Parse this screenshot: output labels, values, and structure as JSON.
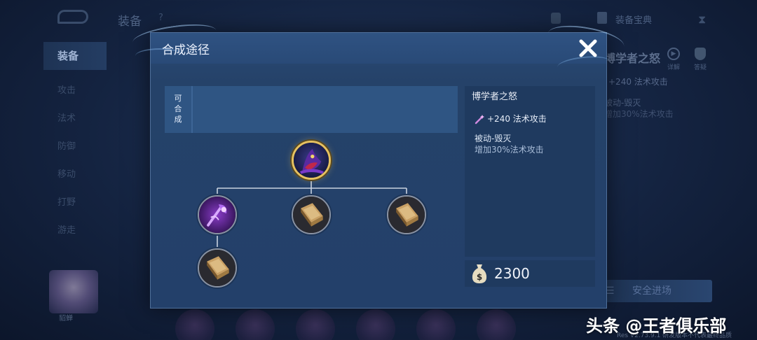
{
  "background": {
    "title": "装备",
    "title_hint": "?",
    "dictionary_label": "装备宝典",
    "sidebar": [
      {
        "label": "装备",
        "active": true
      },
      {
        "label": "攻击",
        "active": false
      },
      {
        "label": "法术",
        "active": false
      },
      {
        "label": "防御",
        "active": false
      },
      {
        "label": "移动",
        "active": false
      },
      {
        "label": "打野",
        "active": false
      },
      {
        "label": "游走",
        "active": false
      }
    ],
    "hero_name": "貂蝉",
    "right_item_name": "博学者之怒",
    "right_stat": "+240 法术攻击",
    "right_passive": "被动-毁灭",
    "right_passive_desc": "增加30%法术攻击",
    "play_label": "详解",
    "drill_label": "答疑",
    "safe_button_label": "安全进场",
    "version_text": "Res V2.73.9.1 研发版本不代表最终品质"
  },
  "dialog": {
    "title": "合成途径",
    "close_icon": "close-x-icon",
    "craftable_label": [
      "可",
      "合",
      "成"
    ],
    "tree": {
      "root": {
        "item": "博学者之怒",
        "icon": "wizard-hat-icon",
        "rarity_color": "#e6c160"
      },
      "children": [
        {
          "item": "梦魇之牙",
          "icon": "purple-staff-icon",
          "children": [
            {
              "item": "咒术典籍",
              "icon": "book-icon"
            }
          ]
        },
        {
          "item": "咒术典籍",
          "icon": "book-icon"
        },
        {
          "item": "咒术典籍",
          "icon": "book-icon"
        }
      ]
    },
    "info": {
      "name": "博学者之怒",
      "stat_icon": "magic-wand-icon",
      "stat": "+240 法术攻击",
      "passive_title": "被动-毁灭",
      "passive_desc": "增加30%法术攻击"
    },
    "price": {
      "icon": "gold-bag-icon",
      "value": "2300"
    }
  },
  "watermark": "头条 @王者俱乐部"
}
